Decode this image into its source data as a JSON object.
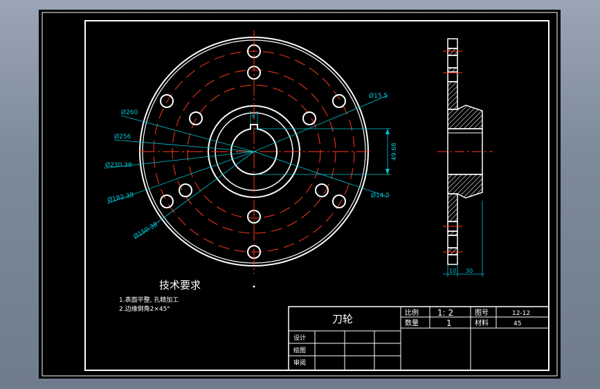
{
  "drawing": {
    "background": "#000000",
    "line_color": "#ffffff",
    "centerline_color": "#ff3a1a",
    "dimension_color": "#00c8d8"
  },
  "dimensions": {
    "d_260": "Ø260",
    "d_256": "Ø256",
    "d_230": "Ø230.38",
    "d_182": "Ø182.38",
    "d_150": "Ø150.38",
    "d_15_5": "Ø15.5",
    "d_14_5": "Ø14.5",
    "key_49": "49.68",
    "key_width": "8",
    "side_10": "10",
    "side_30": "30"
  },
  "tech": {
    "title": "技术要求",
    "line1": "1.表面平整, 孔精加工",
    "line2": "2.边缘倒角2×45°"
  },
  "title_block": {
    "part_name": "刀轮",
    "scale_label": "比例",
    "scale_value": "1: 2",
    "qty_label": "数量",
    "qty_value": "1",
    "drawing_no_label": "图号",
    "drawing_no_value": "12-12",
    "material_label": "材料",
    "material_value": "45",
    "design_label": "设计",
    "draw_label": "绘图",
    "review_label": "审阅"
  }
}
